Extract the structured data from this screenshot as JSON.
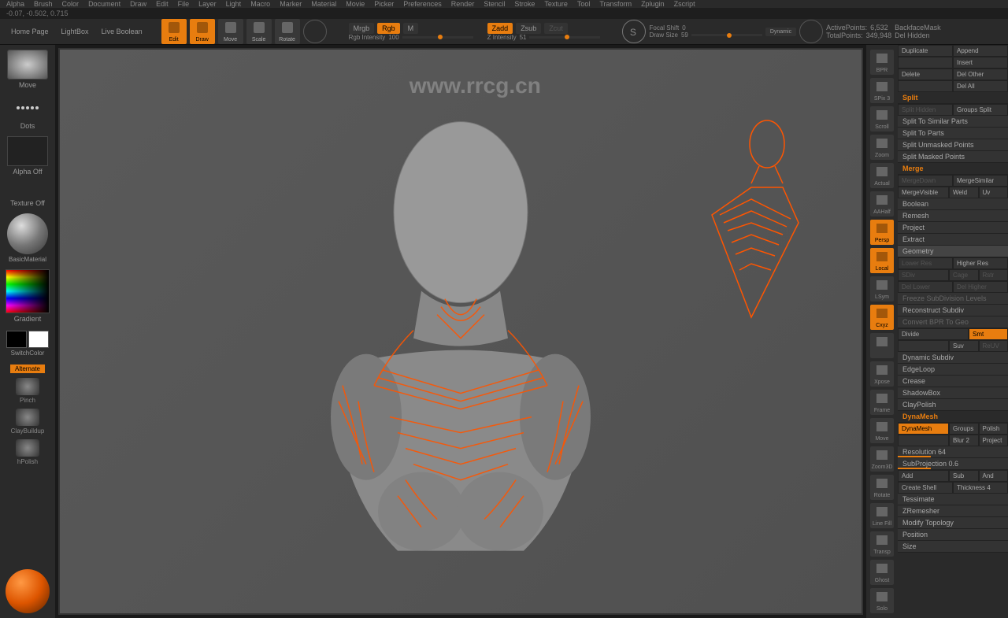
{
  "coords": "-0.07, -0.502, 0.715",
  "menubar": [
    "Alpha",
    "Brush",
    "Color",
    "Document",
    "Draw",
    "Edit",
    "File",
    "Layer",
    "Light",
    "Macro",
    "Marker",
    "Material",
    "Movie",
    "Picker",
    "Preferences",
    "Render",
    "Stencil",
    "Stroke",
    "Texture",
    "Tool",
    "Transform",
    "Zplugin",
    "Zscript"
  ],
  "watermark_url": "www.rrcg.cn",
  "toolbar": {
    "home": "Home Page",
    "lightbox": "LightBox",
    "live_boolean": "Live Boolean",
    "edit": "Edit",
    "draw": "Draw",
    "move": "Move",
    "scale": "Scale",
    "rotate": "Rotate",
    "mrgb": "Mrgb",
    "rgb": "Rgb",
    "m": "M",
    "rgb_intensity_label": "Rgb Intensity",
    "rgb_intensity_val": "100",
    "zadd": "Zadd",
    "zsub": "Zsub",
    "zcut": "Zcut",
    "z_intensity_label": "Z Intensity",
    "z_intensity_val": "51",
    "focal_shift_label": "Focal Shift",
    "focal_shift_val": "0",
    "draw_size_label": "Draw Size",
    "draw_size_val": "59",
    "dynamic": "Dynamic",
    "active_pts_label": "ActivePoints:",
    "active_pts_val": "6,532",
    "total_pts_label": "TotalPoints:",
    "total_pts_val": "349,948",
    "backface": "BackfaceMask",
    "del_hidden": "Del Hidden"
  },
  "left": {
    "brush": "Move",
    "stroke": "Dots",
    "alpha": "Alpha Off",
    "texture": "Texture Off",
    "material": "BasicMaterial",
    "gradient": "Gradient",
    "switch": "SwitchColor",
    "alternate": "Alternate",
    "b1": "Pinch",
    "b2": "ClayBuildup",
    "b3": "hPolish"
  },
  "shelf": [
    "BPR",
    "SPix 3",
    "Scroll",
    "Zoom",
    "Actual",
    "AAHalf",
    "Persp",
    "Local",
    "LSym",
    "Cxyz",
    "",
    "Xpose",
    "Frame",
    "Move",
    "Zoom3D",
    "Rotate",
    "Line Fill",
    "Transp",
    "Ghost",
    "Solo"
  ],
  "shelf_orange": [
    6,
    7,
    9
  ],
  "rpanel": {
    "top": [
      "Append",
      "Insert",
      "Del All"
    ],
    "duplicate": "Duplicate",
    "delete": "Delete",
    "del_other": "Del Other",
    "split": "Split",
    "split_hidden": "Split Hidden",
    "groups_split": "Groups Split",
    "split_similar": "Split To Similar Parts",
    "split_parts": "Split To Parts",
    "split_unmasked": "Split Unmasked Points",
    "split_masked": "Split Masked Points",
    "merge": "Merge",
    "merge_down": "MergeDown",
    "merge_similar": "MergeSimilar",
    "merge_visible": "MergeVisible",
    "weld": "Weld",
    "uv": "Uv",
    "boolean": "Boolean",
    "remesh": "Remesh",
    "project": "Project",
    "extract": "Extract",
    "geometry": "Geometry",
    "lower_res": "Lower Res",
    "higher_res": "Higher Res",
    "sdiv": "SDiv",
    "cage": "Cage",
    "rstr": "Rstr",
    "del_lower": "Del Lower",
    "del_higher": "Del Higher",
    "freeze": "Freeze SubDivision Levels",
    "reconstruct": "Reconstruct Subdiv",
    "convert": "Convert BPR To Geo",
    "divide": "Divide",
    "smt": "Smt",
    "suv": "Suv",
    "reuv": "ReUV",
    "dynamic_subdiv": "Dynamic Subdiv",
    "edgeloop": "EdgeLoop",
    "crease": "Crease",
    "shadowbox": "ShadowBox",
    "claypolish": "ClayPolish",
    "dynamesh_h": "DynaMesh",
    "dynamesh": "DynaMesh",
    "groups": "Groups",
    "polish": "Polish",
    "blur": "Blur 2",
    "project2": "Project",
    "resolution": "Resolution 64",
    "subprojection": "SubProjection 0.6",
    "add": "Add",
    "sub": "Sub",
    "and": "And",
    "create_shell": "Create Shell",
    "thickness": "Thickness 4",
    "tessimate": "Tessimate",
    "zremesher": "ZRemesher",
    "modify_topo": "Modify Topology",
    "position": "Position",
    "size": "Size"
  }
}
